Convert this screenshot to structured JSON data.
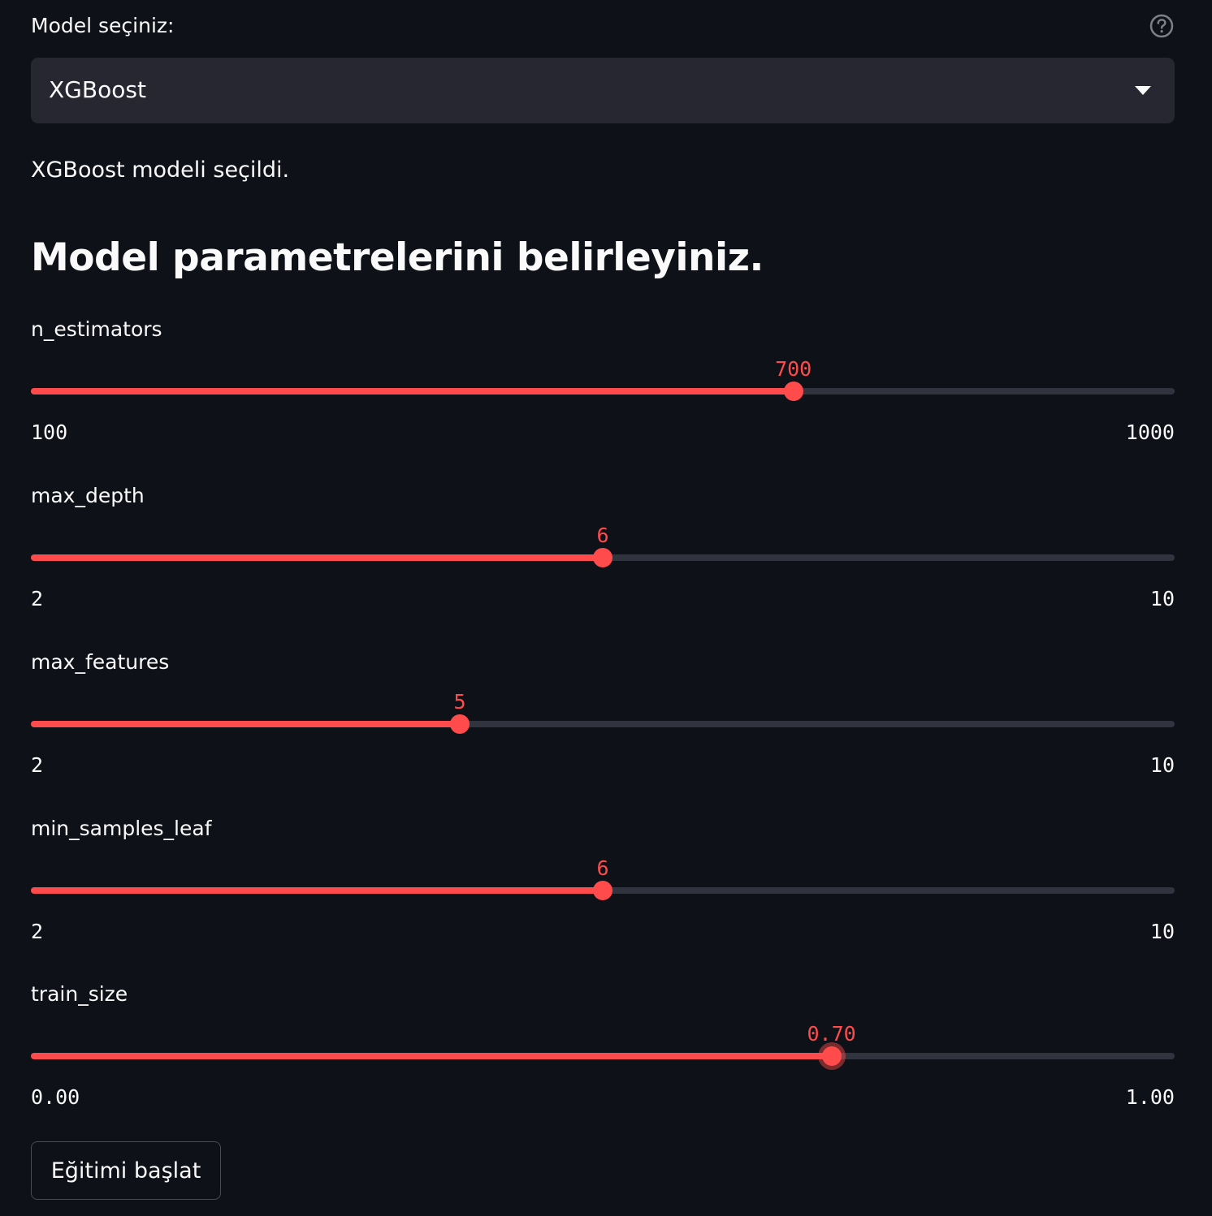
{
  "select": {
    "label": "Model seçiniz:",
    "value": "XGBoost",
    "help_icon": "help-circle-icon",
    "dropdown_icon": "chevron-down-icon"
  },
  "info_text": "XGBoost modeli seçildi.",
  "params_heading": "Model parametrelerini belirleyiniz.",
  "sliders": [
    {
      "label": "n_estimators",
      "value": 700,
      "display_value": "700",
      "min": 100,
      "max": 1000,
      "min_label": "100",
      "max_label": "1000"
    },
    {
      "label": "max_depth",
      "value": 6,
      "display_value": "6",
      "min": 2,
      "max": 10,
      "min_label": "2",
      "max_label": "10"
    },
    {
      "label": "max_features",
      "value": 5,
      "display_value": "5",
      "min": 2,
      "max": 10,
      "min_label": "2",
      "max_label": "10"
    },
    {
      "label": "min_samples_leaf",
      "value": 6,
      "display_value": "6",
      "min": 2,
      "max": 10,
      "min_label": "2",
      "max_label": "10"
    },
    {
      "label": "train_size",
      "value": 0.7,
      "display_value": "0.70",
      "min": 0,
      "max": 1,
      "min_label": "0.00",
      "max_label": "1.00",
      "focused": true
    }
  ],
  "button": {
    "label": "Eğitimi başlat"
  },
  "colors": {
    "accent": "#ff4b4b",
    "background": "#0e1117",
    "input_background": "#262730",
    "track": "#31333f",
    "text": "#fafafa"
  }
}
